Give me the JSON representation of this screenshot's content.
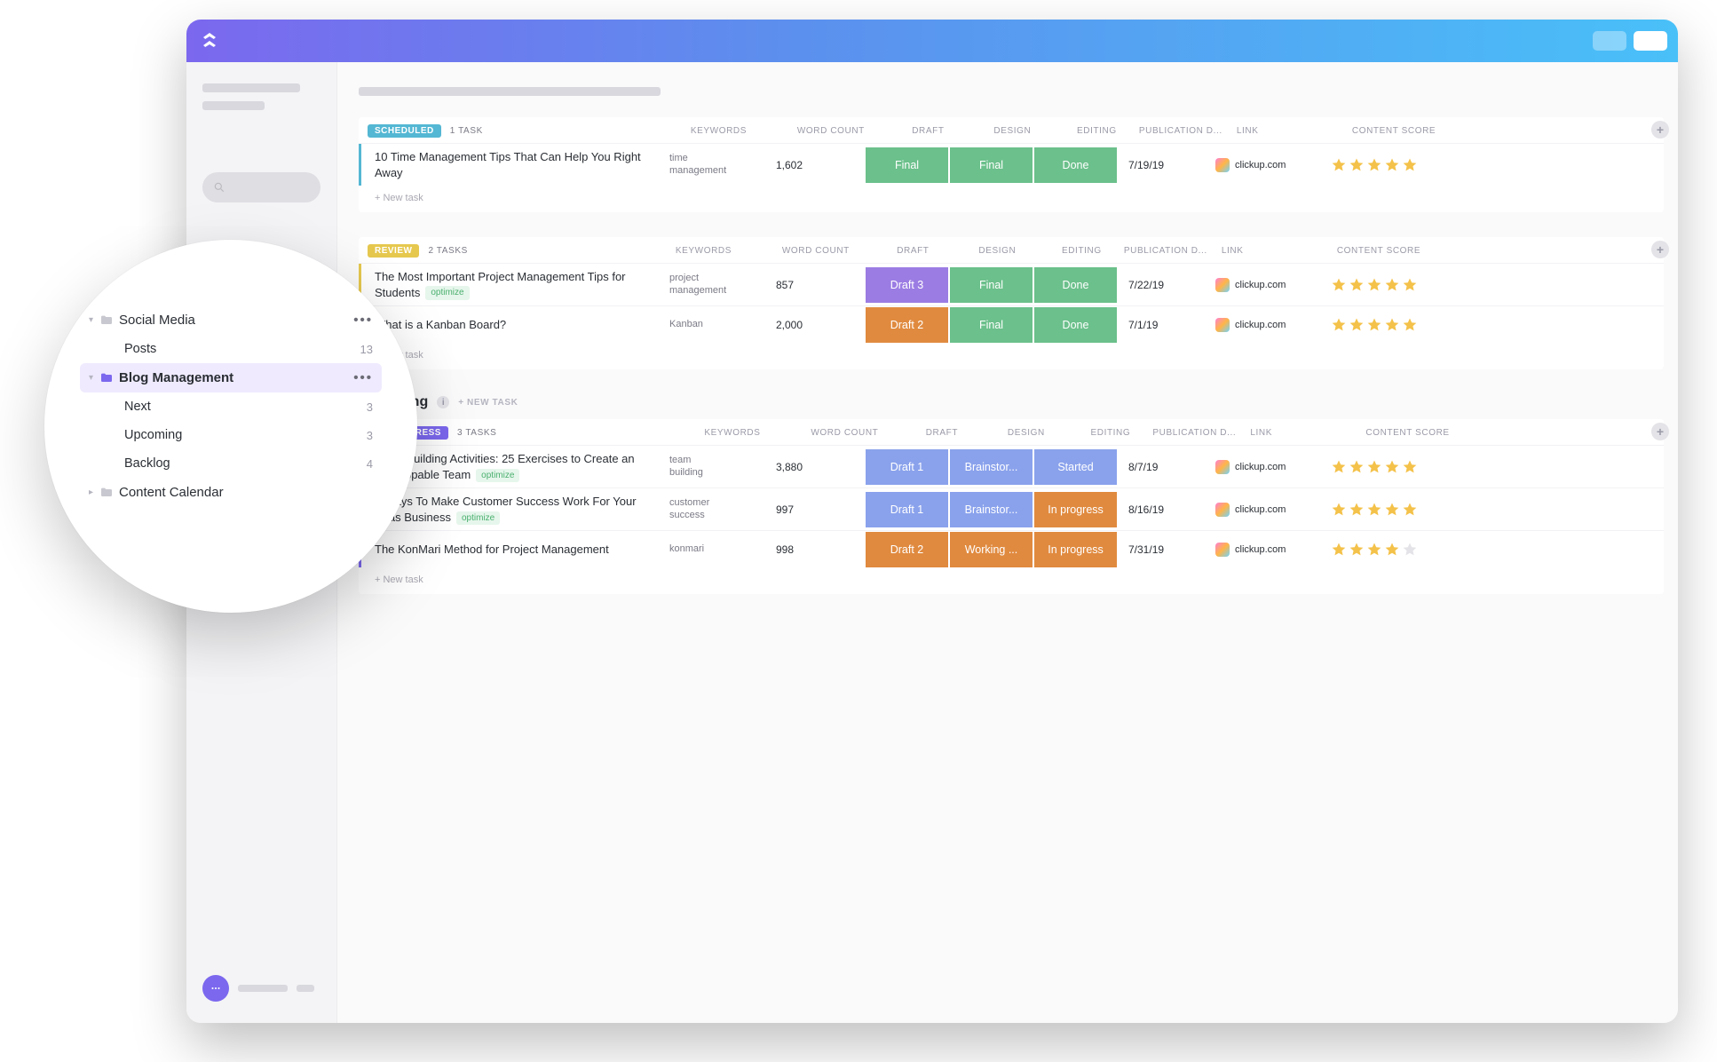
{
  "columns": {
    "keywords": "KEYWORDS",
    "word_count": "WORD COUNT",
    "draft": "DRAFT",
    "design": "DESIGN",
    "editing": "EDITING",
    "pub_date": "PUBLICATION D...",
    "link": "LINK",
    "content_score": "CONTENT SCORE"
  },
  "groups": [
    {
      "id": "scheduled",
      "pill": "SCHEDULED",
      "pill_color": "#54b7d3",
      "stripe_color": "#54b7d3",
      "count_label": "1 TASK",
      "tasks": [
        {
          "title": "10 Time Management Tips That Can Help You Right Away",
          "tag": "",
          "keywords": "time management",
          "word_count": "1,602",
          "draft": {
            "label": "Final",
            "class": "st-green"
          },
          "design": {
            "label": "Final",
            "class": "st-green"
          },
          "editing": {
            "label": "Done",
            "class": "st-green"
          },
          "pub_date": "7/19/19",
          "link": "clickup.com",
          "score": 5
        }
      ]
    },
    {
      "id": "review",
      "pill": "REVIEW",
      "pill_color": "#e6c84f",
      "stripe_color": "#e6c84f",
      "count_label": "2 TASKS",
      "tasks": [
        {
          "title": "The Most Important Project Management Tips for Students",
          "tag": "optimize",
          "keywords": "project management",
          "word_count": "857",
          "draft": {
            "label": "Draft 3",
            "class": "st-purple"
          },
          "design": {
            "label": "Final",
            "class": "st-green"
          },
          "editing": {
            "label": "Done",
            "class": "st-green"
          },
          "pub_date": "7/22/19",
          "link": "clickup.com",
          "score": 5
        },
        {
          "title": "What is a Kanban Board?",
          "tag": "",
          "keywords": "Kanban",
          "word_count": "2,000",
          "draft": {
            "label": "Draft 2",
            "class": "st-orange"
          },
          "design": {
            "label": "Final",
            "class": "st-green"
          },
          "editing": {
            "label": "Done",
            "class": "st-green"
          },
          "pub_date": "7/1/19",
          "link": "clickup.com",
          "score": 5
        }
      ]
    }
  ],
  "section": {
    "title": "Upcoming",
    "new_task_label": "+ NEW TASK"
  },
  "groups2": [
    {
      "id": "inprogress",
      "pill": "IN PROGRESS",
      "pill_color": "#7B68EE",
      "stripe_color": "#7B68EE",
      "count_label": "3 TASKS",
      "tasks": [
        {
          "title": "Team Building Activities: 25 Exercises to Create an Unstoppable Team",
          "tag": "optimize",
          "keywords": "team building",
          "word_count": "3,880",
          "draft": {
            "label": "Draft 1",
            "class": "st-blue"
          },
          "design": {
            "label": "Brainstor...",
            "class": "st-blue"
          },
          "editing": {
            "label": "Started",
            "class": "st-blue"
          },
          "pub_date": "8/7/19",
          "link": "clickup.com",
          "score": 5
        },
        {
          "title": "3 Ways To Make Customer Success Work For Your Saas Business",
          "tag": "optimize",
          "keywords": "customer success",
          "word_count": "997",
          "draft": {
            "label": "Draft 1",
            "class": "st-blue"
          },
          "design": {
            "label": "Brainstor...",
            "class": "st-blue"
          },
          "editing": {
            "label": "In progress",
            "class": "st-orange"
          },
          "pub_date": "8/16/19",
          "link": "clickup.com",
          "score": 5
        },
        {
          "title": "The KonMari Method for Project Management",
          "tag": "",
          "keywords": "konmari",
          "word_count": "998",
          "draft": {
            "label": "Draft 2",
            "class": "st-orange"
          },
          "design": {
            "label": "Working ...",
            "class": "st-orange"
          },
          "editing": {
            "label": "In progress",
            "class": "st-orange"
          },
          "pub_date": "7/31/19",
          "link": "clickup.com",
          "score": 4
        }
      ]
    }
  ],
  "new_task_label": "+ New task",
  "lens": {
    "items": [
      {
        "type": "folder",
        "label": "Social Media",
        "expanded": true,
        "right": "dots"
      },
      {
        "type": "sub",
        "label": "Posts",
        "count": "13"
      },
      {
        "type": "folder",
        "label": "Blog Management",
        "expanded": true,
        "active": true,
        "right": "dots",
        "color": "#7B68EE"
      },
      {
        "type": "sub",
        "label": "Next",
        "count": "3"
      },
      {
        "type": "sub",
        "label": "Upcoming",
        "count": "3"
      },
      {
        "type": "sub",
        "label": "Backlog",
        "count": "4"
      },
      {
        "type": "folder",
        "label": "Content Calendar",
        "expanded": false
      }
    ]
  }
}
